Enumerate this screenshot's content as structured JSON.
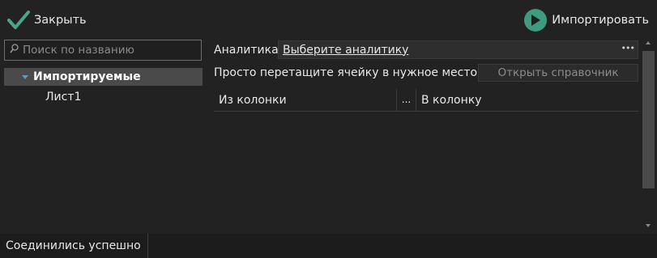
{
  "toolbar": {
    "close_label": "Закрыть",
    "import_label": "Импортировать"
  },
  "left_panel": {
    "search_placeholder": "Поиск по названию",
    "tree": {
      "root_label": "Импортируемые",
      "children": [
        "Лист1"
      ]
    }
  },
  "right_panel": {
    "analytics_label": "Аналитика",
    "analytics_value": "Выберите аналитику",
    "drag_hint": "Просто перетащите ячейку в нужное место...",
    "open_reference_button": "Открыть справочник",
    "columns": {
      "from": "Из колонки",
      "dots": "...",
      "to": "В колонку"
    }
  },
  "status": {
    "text": "Соединились успешно"
  },
  "colors": {
    "background": "#222222",
    "accent_green": "#3f9b80",
    "tree_caret": "#4aa0d8"
  }
}
